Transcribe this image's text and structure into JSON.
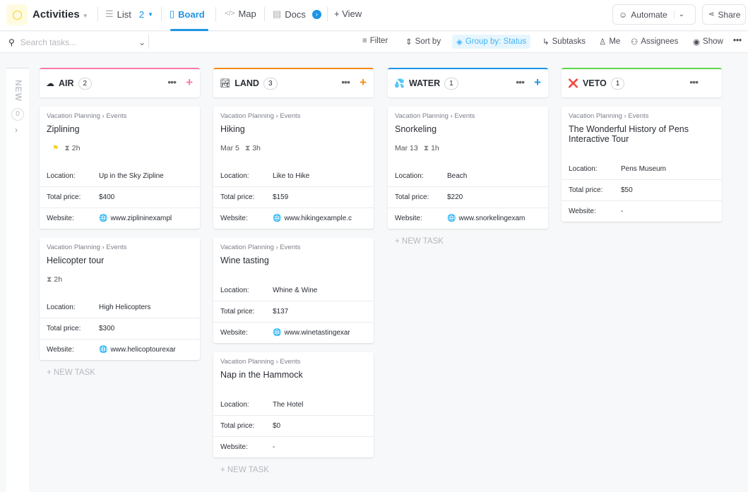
{
  "header": {
    "title": "Activities",
    "tabs": [
      {
        "label": "List",
        "count": "2"
      },
      {
        "label": "Board"
      },
      {
        "label": "Map"
      },
      {
        "label": "Docs"
      },
      {
        "label": "+ View"
      }
    ],
    "automate": "Automate",
    "share": "Share"
  },
  "toolbar": {
    "search_placeholder": "Search tasks...",
    "filter": "Filter",
    "sort": "Sort by",
    "group": "Group by: Status",
    "subtasks": "Subtasks",
    "me": "Me",
    "assignees": "Assignees",
    "show": "Show"
  },
  "new_column": {
    "label": "NEW",
    "count": "0"
  },
  "labels": {
    "location": "Location:",
    "price": "Total price:",
    "website": "Website:",
    "new_task": "+ NEW TASK"
  },
  "columns": [
    {
      "name": "AIR",
      "count": "2",
      "icon": "☁",
      "color": "#f97ca6",
      "tasks": [
        {
          "breadcrumb": "Vacation Planning  › Events",
          "title": "Ziplining",
          "flag": true,
          "date": "",
          "duration": "2h",
          "location": "Up in the Sky Zipline",
          "price": "$400",
          "website": "www.ziplininexampl"
        },
        {
          "breadcrumb": "Vacation Planning  › Events",
          "title": "Helicopter tour",
          "flag": false,
          "date": "",
          "duration": "2h",
          "location": "High Helicopters",
          "price": "$300",
          "website": "www.helicoptourexar"
        }
      ]
    },
    {
      "name": "LAND",
      "count": "3",
      "icon": "🏞",
      "color": "#f58b14",
      "tasks": [
        {
          "breadcrumb": "Vacation Planning  › Events",
          "title": "Hiking",
          "flag": false,
          "date": "Mar 5",
          "duration": "3h",
          "location": "Like to Hike",
          "price": "$159",
          "website": "www.hikingexample.c"
        },
        {
          "breadcrumb": "Vacation Planning  › Events",
          "title": "Wine tasting",
          "location": "Whine & Wine",
          "price": "$137",
          "website": "www.winetastingexar"
        },
        {
          "breadcrumb": "Vacation Planning  › Events",
          "title": "Nap in the Hammock",
          "location": "The Hotel",
          "price": "$0",
          "website": "-"
        }
      ]
    },
    {
      "name": "WATER",
      "count": "1",
      "icon": "💦",
      "color": "#1c94e6",
      "tasks": [
        {
          "breadcrumb": "Vacation Planning  › Events",
          "title": "Snorkeling",
          "flag": false,
          "date": "Mar 13",
          "duration": "1h",
          "location": "Beach",
          "price": "$220",
          "website": "www.snorkelingexam"
        }
      ]
    },
    {
      "name": "VETO",
      "count": "1",
      "icon": "❌",
      "color": "#5ed84a",
      "tasks": [
        {
          "breadcrumb": "Vacation Planning  › Events",
          "title": "The Wonderful History of Pens Interactive Tour",
          "location": "Pens Museum",
          "price": "$50",
          "website": "-"
        }
      ]
    }
  ]
}
